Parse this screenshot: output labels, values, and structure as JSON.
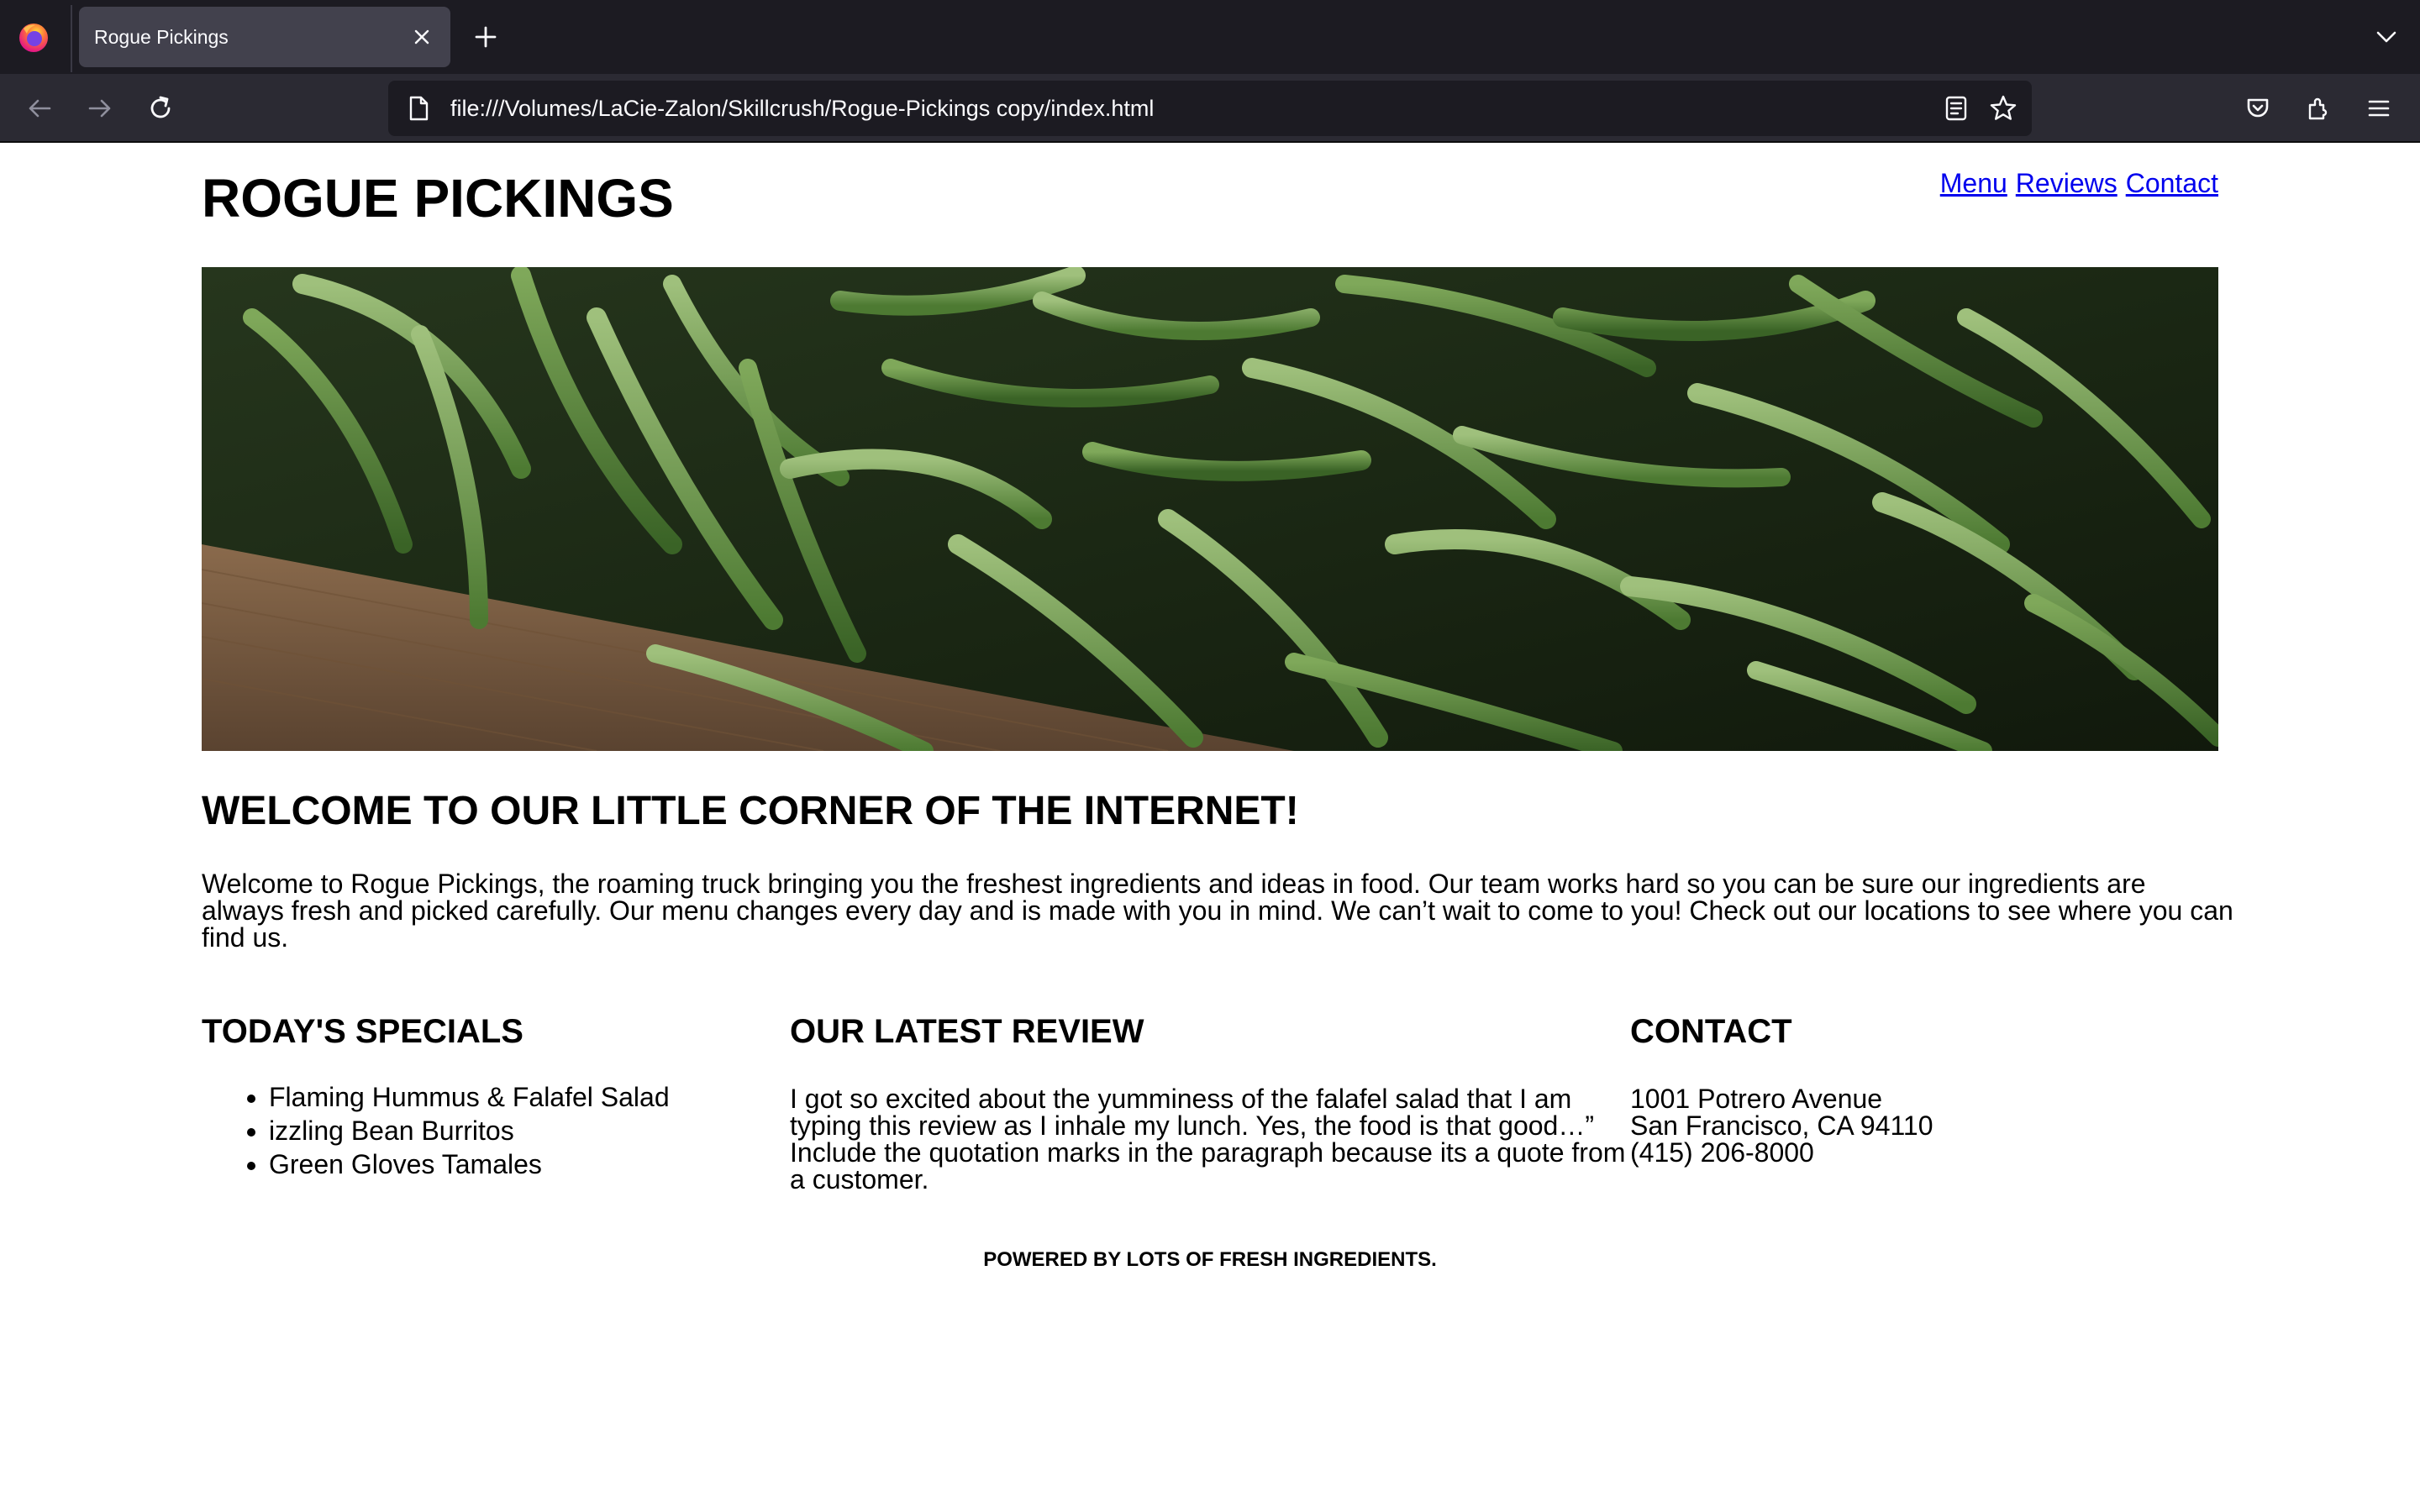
{
  "browser": {
    "tab_title": "Rogue Pickings",
    "url": "file:///Volumes/LaCie-Zalon/Skillcrush/Rogue-Pickings copy/index.html",
    "colors": {
      "tabbar_bg": "#1c1b22",
      "navbar_bg": "#2b2a33",
      "active_tab_bg": "#42414d",
      "text": "#fbfbfe"
    },
    "icons": [
      "firefox-logo",
      "close-icon",
      "plus-icon",
      "chevron-down-icon",
      "back-arrow-icon",
      "forward-arrow-icon",
      "reload-icon",
      "page-icon",
      "reader-view-icon",
      "star-icon",
      "pocket-icon",
      "extensions-icon",
      "hamburger-menu-icon"
    ]
  },
  "site": {
    "title": "ROGUE PICKINGS",
    "nav": {
      "menu": "Menu",
      "reviews": "Reviews",
      "contact": "Contact"
    },
    "link_color": "#0000ee",
    "hero_image": "green-beans-photo",
    "welcome": {
      "heading": "WELCOME TO OUR LITTLE CORNER OF THE INTERNET!",
      "text": "Welcome to Rogue Pickings, the roaming truck bringing you the freshest ingredients and ideas in food. Our team works hard so you can be sure our ingredients are always fresh and picked carefully. Our menu changes every day and is made with you in mind. We can’t wait to come to you! Check out our locations to see where you can find us."
    },
    "specials": {
      "heading": "TODAY'S SPECIALS",
      "items": [
        "Flaming Hummus & Falafel Salad",
        "izzling Bean Burritos",
        "Green Gloves Tamales"
      ]
    },
    "review": {
      "heading": "OUR LATEST REVIEW",
      "text": "I got so excited about the yumminess of the falafel salad that I am typing this review as I inhale my lunch. Yes, the food is that good…” Include the quotation marks in the paragraph because its a quote from a customer."
    },
    "contact": {
      "heading": "CONTACT",
      "address_line1": "1001 Potrero Avenue",
      "address_line2": "San Francisco, CA 94110",
      "phone": "(415) 206-8000"
    },
    "footer": "POWERED BY LOTS OF FRESH INGREDIENTS."
  }
}
